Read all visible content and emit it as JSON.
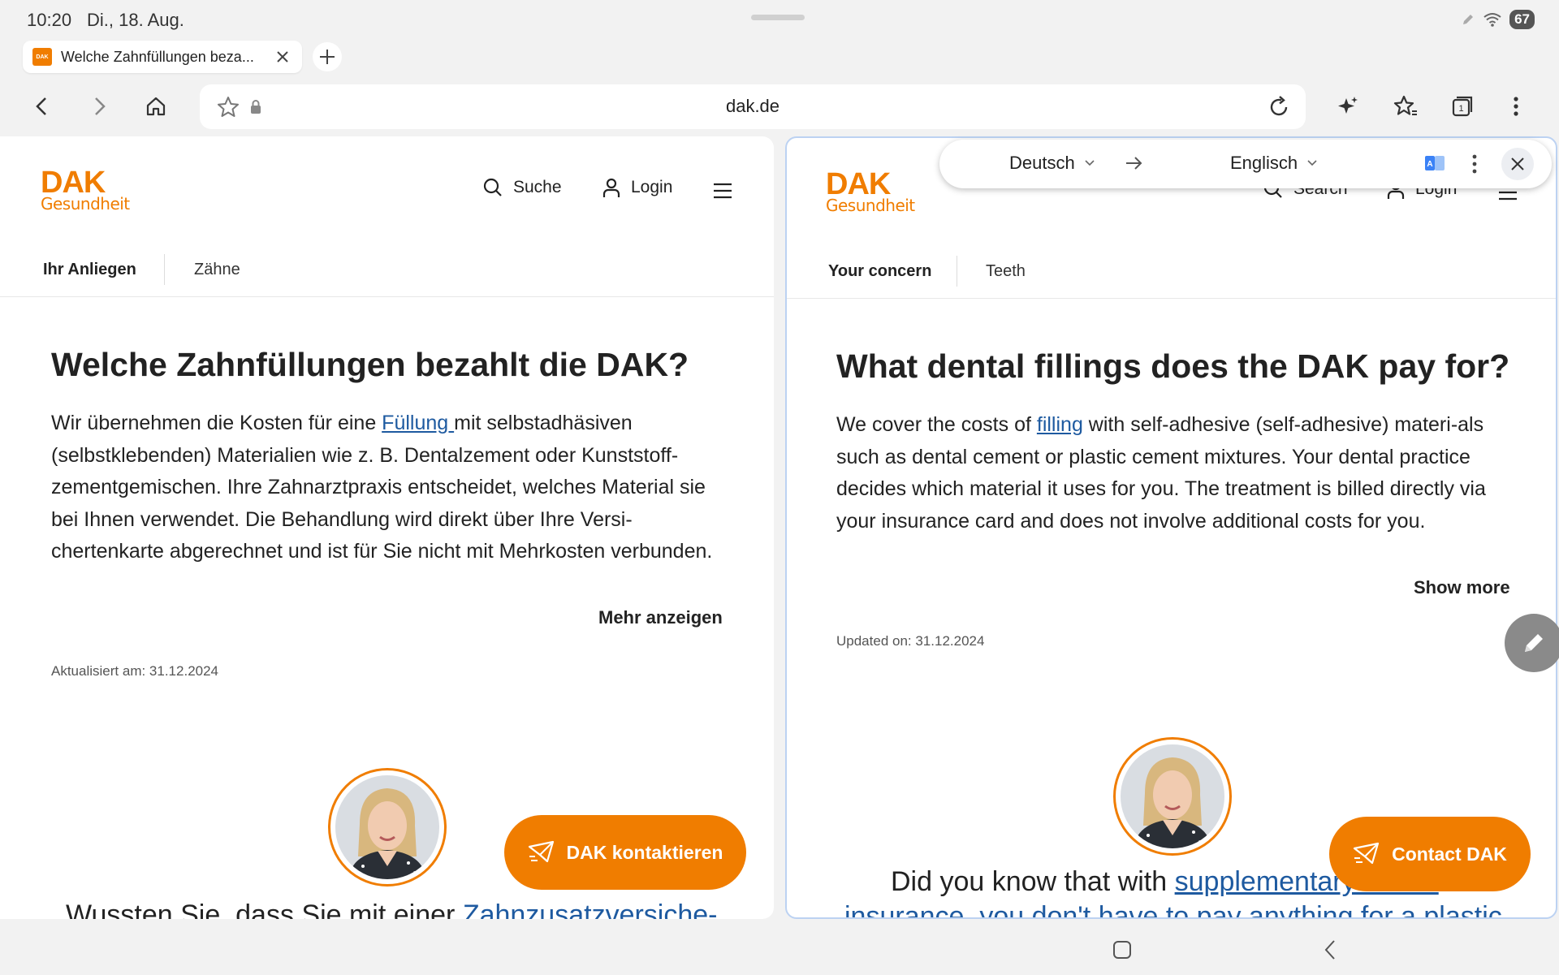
{
  "status_bar": {
    "time": "10:20",
    "date": "Di., 18. Aug.",
    "battery": "67"
  },
  "tab": {
    "title": "Welche Zahnfüllungen beza...",
    "favicon_text": "DAK"
  },
  "toolbar": {
    "url": "dak.de"
  },
  "left_page": {
    "logo_main": "DAK",
    "logo_sub": "Gesundheit",
    "nav": {
      "search": "Suche",
      "login": "Login"
    },
    "breadcrumb": {
      "first": "Ihr Anliegen",
      "second": "Zähne"
    },
    "headline": "Welche Zahnfüllungen bezahlt die DAK?",
    "paragraph": {
      "before_link": "Wir übernehmen die Kosten für eine ",
      "link": "Füllung ",
      "after_link": "mit selbstadhäsiven (selbstklebenden) Materialien wie z. B. Dentalzement oder Kunststoff-zementgemischen. Ihre Zahnarztpraxis entscheidet, welches Material sie bei Ihnen verwendet. Die Behandlung wird direkt über Ihre Versi-chertenkarte abgerechnet und ist für Sie nicht mit Mehrkosten verbunden."
    },
    "show_more": "Mehr anzeigen",
    "updated": "Aktualisiert am: 31.12.2024",
    "contact_button": "DAK kontaktieren",
    "teaser": {
      "before_link": "Wussten Sie, dass Sie mit einer ",
      "link": "Zahnzusatzversiche-"
    }
  },
  "right_page": {
    "logo_main": "DAK",
    "logo_sub": "Gesundheit",
    "nav": {
      "search": "Search",
      "login": "Login"
    },
    "breadcrumb": {
      "first": "Your concern",
      "second": "Teeth"
    },
    "headline": "What dental fillings does the DAK pay for?",
    "paragraph": {
      "before_link": "We cover the costs of ",
      "link": "filling",
      "after_link": " with self-adhesive (self-adhesive) materi-als such as dental cement or plastic cement mixtures. Your dental practice decides which material it uses for you. The treatment is billed directly via your insurance card and does not involve additional costs for you."
    },
    "show_more": "Show more",
    "updated": "Updated on: 31.12.2024",
    "contact_button": "Contact DAK",
    "teaser": {
      "before_link": "Did you know that with ",
      "link": "supplementary dental",
      "line2": "insurance, you don't have to pay anything for a plastic"
    }
  },
  "translation_bar": {
    "source_lang": "Deutsch",
    "target_lang": "Englisch"
  },
  "colors": {
    "brand_orange": "#f07d00",
    "link_blue": "#1e5aa0",
    "pane_border": "#bcd2f2"
  },
  "icons": [
    "wifi-icon",
    "pen-icon",
    "back-icon",
    "forward-icon",
    "home-icon",
    "star-icon",
    "lock-icon",
    "reload-icon",
    "sparkle-icon",
    "bookmarks-icon",
    "tabs-icon",
    "more-icon",
    "search-icon",
    "user-icon",
    "menu-icon",
    "send-icon",
    "translate-icon",
    "close-icon",
    "edit-icon",
    "recents-icon",
    "nav-back-icon"
  ]
}
